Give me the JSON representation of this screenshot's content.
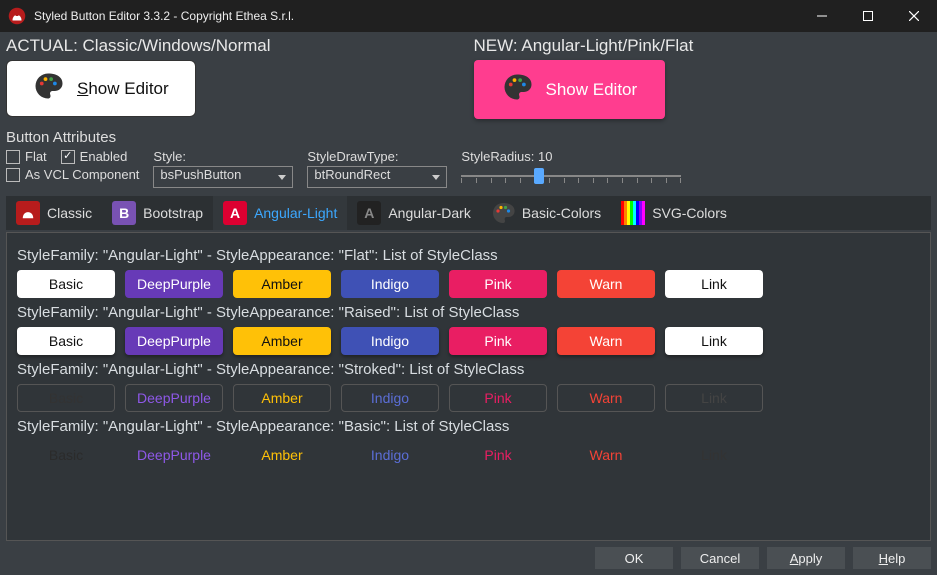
{
  "window": {
    "title": "Styled Button Editor 3.3.2 - Copyright Ethea S.r.l."
  },
  "preview": {
    "actual_label": "ACTUAL: Classic/Windows/Normal",
    "actual_button": "Show Editor",
    "new_label": "NEW: Angular-Light/Pink/Flat",
    "new_button": "Show Editor"
  },
  "attrs": {
    "title": "Button Attributes",
    "flat_label": "Flat",
    "flat_checked": false,
    "enabled_label": "Enabled",
    "enabled_checked": true,
    "asvcl_label": "As VCL Component",
    "asvcl_checked": false,
    "style_label": "Style:",
    "style_value": "bsPushButton",
    "drawtype_label": "StyleDrawType:",
    "drawtype_value": "btRoundRect",
    "radius_label": "StyleRadius: 10",
    "radius_value": 10,
    "radius_min": 0,
    "radius_max": 30
  },
  "tabs": [
    {
      "label": "Classic"
    },
    {
      "label": "Bootstrap"
    },
    {
      "label": "Angular-Light",
      "active": true
    },
    {
      "label": "Angular-Dark"
    },
    {
      "label": "Basic-Colors"
    },
    {
      "label": "SVG-Colors"
    }
  ],
  "groups": [
    {
      "header": "StyleFamily: \"Angular-Light\" - StyleAppearance: \"Flat\": List of StyleClass",
      "style": "flat"
    },
    {
      "header": "StyleFamily: \"Angular-Light\" - StyleAppearance: \"Raised\": List of StyleClass",
      "style": "raised"
    },
    {
      "header": "StyleFamily: \"Angular-Light\" - StyleAppearance: \"Stroked\": List of StyleClass",
      "style": "stroked"
    },
    {
      "header": "StyleFamily: \"Angular-Light\" - StyleAppearance: \"Basic\": List of StyleClass",
      "style": "basic"
    }
  ],
  "classes": [
    "Basic",
    "DeepPurple",
    "Amber",
    "Indigo",
    "Pink",
    "Warn",
    "Link"
  ],
  "footer": {
    "ok": "OK",
    "cancel": "Cancel",
    "apply": "Apply",
    "help": "Help"
  }
}
